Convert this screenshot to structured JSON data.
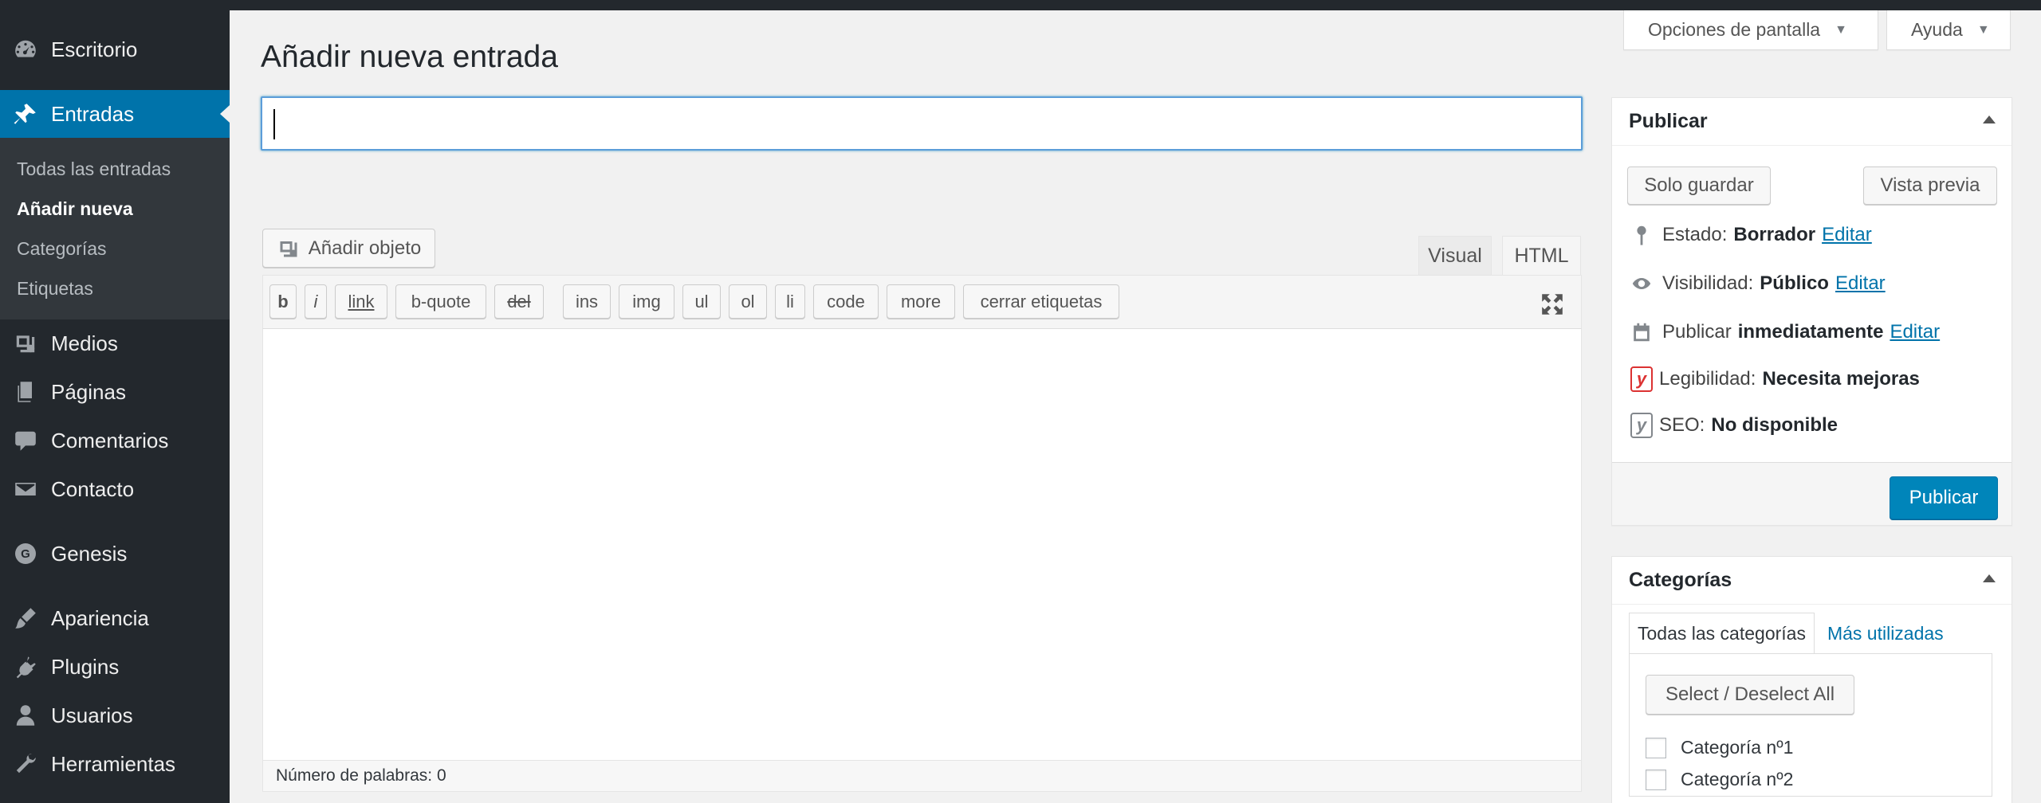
{
  "sidebar": {
    "items": [
      {
        "label": "Escritorio",
        "icon": "dashboard-icon"
      },
      {
        "label": "Entradas",
        "icon": "pin-icon"
      },
      {
        "label": "Medios",
        "icon": "media-icon"
      },
      {
        "label": "Páginas",
        "icon": "pages-icon"
      },
      {
        "label": "Comentarios",
        "icon": "comments-icon"
      },
      {
        "label": "Contacto",
        "icon": "mail-icon"
      },
      {
        "label": "Genesis",
        "icon": "genesis-icon"
      },
      {
        "label": "Apariencia",
        "icon": "brush-icon"
      },
      {
        "label": "Plugins",
        "icon": "plugin-icon"
      },
      {
        "label": "Usuarios",
        "icon": "user-icon"
      },
      {
        "label": "Herramientas",
        "icon": "wrench-icon"
      }
    ],
    "submenu": [
      "Todas las entradas",
      "Añadir nueva",
      "Categorías",
      "Etiquetas"
    ],
    "genesis_letter": "G"
  },
  "header": {
    "screen_options": "Opciones de pantalla",
    "help": "Ayuda",
    "dropdown_glyph": "▼"
  },
  "main": {
    "page_title": "Añadir nueva entrada",
    "title_input_value": "",
    "add_media": "Añadir objeto",
    "tabs": {
      "visual": "Visual",
      "html": "HTML"
    },
    "quicktags": [
      "b",
      "i",
      "link",
      "b-quote",
      "del",
      "ins",
      "img",
      "ul",
      "ol",
      "li",
      "code",
      "more",
      "cerrar etiquetas"
    ],
    "word_count": "Número de palabras: 0"
  },
  "publish": {
    "title": "Publicar",
    "save_draft": "Solo guardar",
    "preview": "Vista previa",
    "status_label": "Estado:",
    "status_value": "Borrador",
    "visibility_label": "Visibilidad:",
    "visibility_value": "Público",
    "schedule_label": "Publicar",
    "schedule_value": "inmediatamente",
    "edit": "Editar",
    "readability_label": "Legibilidad:",
    "readability_value": "Necesita mejoras",
    "seo_label": "SEO:",
    "seo_value": "No disponible",
    "yoast_glyph": "y",
    "publish_button": "Publicar"
  },
  "categories": {
    "title": "Categorías",
    "tab_all": "Todas las categorías",
    "tab_popular": "Más utilizadas",
    "select_all": "Select / Deselect All",
    "items": [
      "Categoría nº1",
      "Categoría nº2"
    ]
  },
  "colors": {
    "sidebar_bg": "#23282d",
    "accent": "#0073aa",
    "primary_button": "#0085ba",
    "readability_status": "#dc3232"
  }
}
